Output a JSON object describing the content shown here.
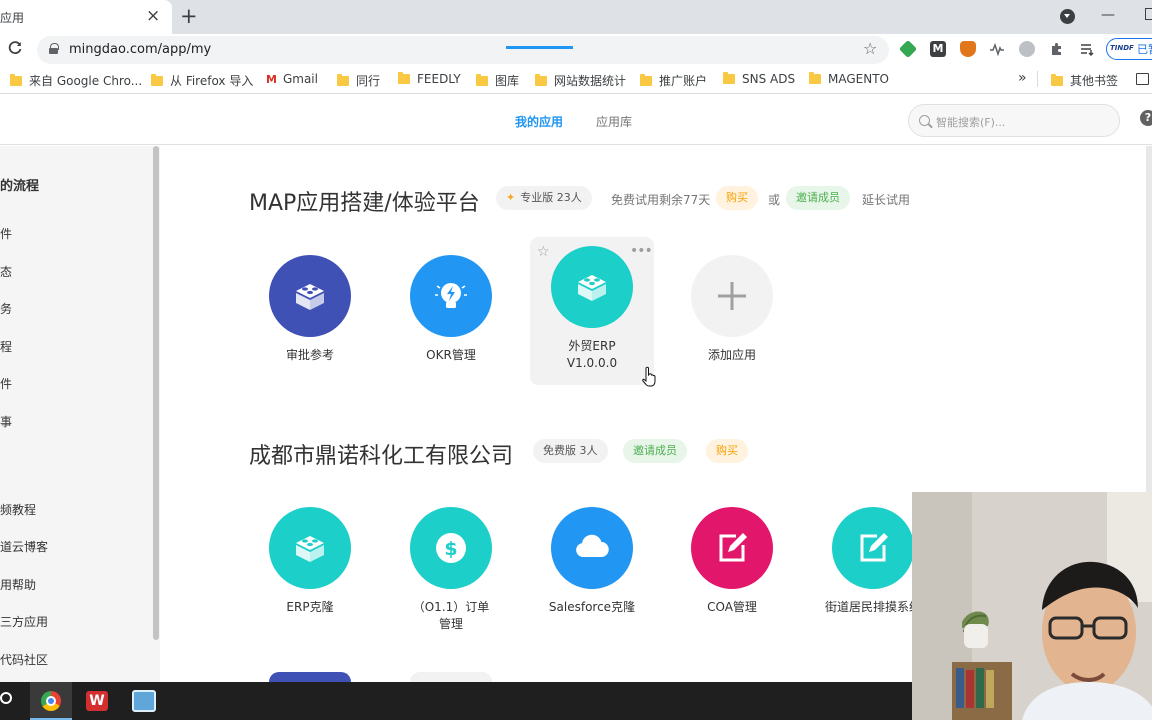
{
  "browser": {
    "tab_title": "应用",
    "tab_close": "×",
    "new_tab": "+",
    "url": "mingdao.com/app/my",
    "reload": "C",
    "star": "☆",
    "ext_m": "M",
    "profile_label": "已暂",
    "profile_avatar": "TINDF",
    "bookmarks": [
      {
        "label": "来自 Google Chro..."
      },
      {
        "label": "从 Firefox 导入"
      },
      {
        "label": "Gmail"
      },
      {
        "label": "同行"
      },
      {
        "label": "FEEDLY"
      },
      {
        "label": "图库"
      },
      {
        "label": "网站数据统计"
      },
      {
        "label": "推广账户"
      },
      {
        "label": "SNS ADS"
      },
      {
        "label": "MAGENTO"
      }
    ],
    "more_bookmarks": "»",
    "other_bookmarks": "其他书签"
  },
  "header": {
    "tabs": [
      {
        "label": "我的应用",
        "active": true
      },
      {
        "label": "应用库",
        "active": false
      }
    ],
    "search_placeholder": "智能搜索(F)...",
    "help": "?"
  },
  "sidebar": {
    "items": [
      "的流程",
      "件",
      "态",
      "务",
      "程",
      "件",
      "事",
      "频教程",
      "道云博客",
      "用帮助",
      "三方应用",
      "代码社区"
    ]
  },
  "groups": [
    {
      "title": "MAP应用搭建/体验平台",
      "plan": "专业版 23人",
      "trial": "免费试用剩余77天",
      "buy": "购买",
      "or": "或",
      "invite": "邀请成员",
      "extend": "延长试用",
      "apps": [
        {
          "name": "审批参考",
          "icon": "lego-icon",
          "color": "#3f51b5"
        },
        {
          "name": "OKR管理",
          "icon": "bulb-icon",
          "color": "#2196f3"
        },
        {
          "name": "外贸ERP V1.0.0.0",
          "icon": "lego-icon",
          "color": "#1ccfc9"
        },
        {
          "name": "添加应用",
          "icon": "plus-icon",
          "color": "#f2f2f2"
        }
      ]
    },
    {
      "title": "成都市鼎诺科化工有限公司",
      "plan": "免费版 3人",
      "invite": "邀请成员",
      "buy": "购买",
      "apps": [
        {
          "name": "ERP克隆",
          "icon": "lego-icon",
          "color": "#1ccfc9"
        },
        {
          "name": "（O1.1）订单管理",
          "icon": "dollar-icon",
          "color": "#1ccfc9"
        },
        {
          "name": "Salesforce克隆",
          "icon": "cloud-icon",
          "color": "#2196f3"
        },
        {
          "name": "COA管理",
          "icon": "edit-icon",
          "color": "#e2176b"
        },
        {
          "name": "街道居民排摸系统",
          "icon": "edit-icon",
          "color": "#1ccfc9"
        }
      ]
    }
  ]
}
